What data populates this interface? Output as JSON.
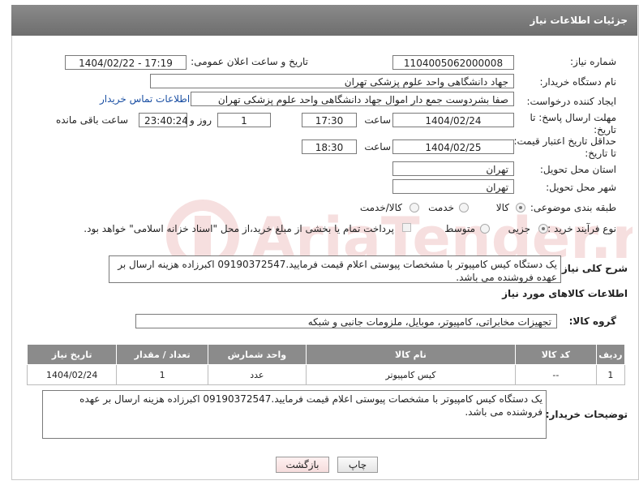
{
  "header": {
    "title": "جزئیات اطلاعات نیاز"
  },
  "form": {
    "need_number_label": "شماره نیاز:",
    "need_number": "1104005062000008",
    "announce_label": "تاریخ و ساعت اعلان عمومی:",
    "announce_value": "1404/02/22 - 17:19",
    "buyer_org_label": "نام دستگاه خریدار:",
    "buyer_org": "جهاد دانشگاهی واحد علوم پزشکی تهران",
    "creator_label": "ایجاد کننده درخواست:",
    "creator": "صفا بشردوست جمع دار اموال  جهاد دانشگاهی واحد علوم پزشکی تهران",
    "contact_link": "اطلاعات تماس خریدار",
    "deadline_label_1": "مهلت ارسال پاسخ: تا",
    "deadline_label_2": "تاریخ:",
    "deadline_date": "1404/02/24",
    "time_label": "ساعت",
    "deadline_time": "17:30",
    "days_value": "1",
    "days_label": "روز و",
    "remaining_time": "23:40:24",
    "remaining_label": "ساعت باقی مانده",
    "validity_label_1": "حداقل تاریخ اعتبار قیمت:",
    "validity_label_2": "تا تاریخ:",
    "validity_date": "1404/02/25",
    "validity_time_label": "ساعت",
    "validity_time": "18:30",
    "province_label": "استان محل تحویل:",
    "province": "تهران",
    "city_label": "شهر محل تحویل:",
    "city": "تهران",
    "category_label": "طبقه بندی موضوعی:",
    "category_options": [
      "کالا",
      "خدمت",
      "کالا/خدمت"
    ],
    "process_label": "نوع فرآیند خرید :",
    "process_options": [
      "جزیی",
      "متوسط"
    ],
    "payment_note": "پرداخت تمام یا بخشی از مبلغ خرید،از محل \"اسناد خزانه اسلامی\" خواهد بود.",
    "description_label": "شرح کلی نیاز:",
    "description": "یک دستگاه کیس کامپیوتر با مشخصات پیوستی اعلام قیمت فرمایید.09190372547 اکبرزاده هزینه ارسال بر عهده فروشنده می باشد."
  },
  "goods": {
    "section_title": "اطلاعات کالاهای مورد نیاز",
    "group_label": "گروه کالا:",
    "group_value": "تجهیزات مخابراتی، کامپیوتر، موبایل، ملزومات جانبی و شبکه",
    "columns": [
      "ردیف",
      "کد کالا",
      "نام کالا",
      "واحد شمارش",
      "تعداد / مقدار",
      "تاریخ نیاز"
    ],
    "rows": [
      [
        "1",
        "--",
        "کیس کامپیوتر",
        "عدد",
        "1",
        "1404/02/24"
      ]
    ]
  },
  "buyer_notes": {
    "label": "توضیحات خریدار:",
    "text": "یک دستگاه کیس کامپیوتر با مشخصات پیوستی اعلام قیمت فرمایید.09190372547 اکبرزاده هزینه ارسال بر عهده فروشنده می باشد."
  },
  "buttons": {
    "print": "چاپ",
    "back": "بازگشت"
  },
  "watermark": {
    "text": "AriaTender.neT"
  },
  "colors": {
    "header_bg": "#7c7c7c",
    "link": "#1a4fa3",
    "watermark": "#c62828"
  }
}
